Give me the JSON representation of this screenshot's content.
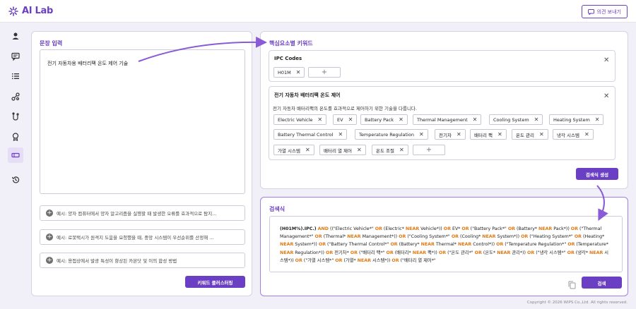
{
  "app": {
    "logo_text": "AI Lab",
    "feedback_label": "의견 보내기"
  },
  "nav": {
    "icons": [
      "user-icon",
      "chat-icon",
      "list-icon",
      "network-icon",
      "flow-icon",
      "award-icon",
      "ticket-icon",
      "history-icon"
    ],
    "active_index": 6
  },
  "input_panel": {
    "title": "문장 입력",
    "text": "전기 자동차용 배터리팩 온도 제어 기술",
    "examples": [
      "예시: 양자 컴퓨터에서 양자 알고리즘을 실행할 때 발생한 오류를 효과적으로 탐지...",
      "예시: 로봇택시가 원격지 도움을 요청했을 때, 중앙 시스템이 우선순위를 산정해 ...",
      "예시: 용접상에서 발광 특성이 향상된 카본닷 및 이의 합성 방법"
    ],
    "cluster_button": "키워드 클러스터링"
  },
  "keyword_panel": {
    "title": "핵심요소별 키워드",
    "ipc_card": {
      "title": "IPC Codes",
      "chips": [
        "H01M"
      ]
    },
    "topic_card": {
      "title": "전기 자동차 배터리팩 온도 제어",
      "description": "전기 자동차 배터리팩의 온도를 효과적으로 제어하기 위한 기술을 다룹니다.",
      "chips": [
        "Electric Vehicle",
        "EV",
        "Battery Pack",
        "Thermal Management",
        "Cooling System",
        "Heating System",
        "Battery Thermal Control",
        "Temperature Regulation",
        "전기차",
        "배터리 팩",
        "온도 관리",
        "냉각 시스템",
        "가열 시스템",
        "배터리 열 제어",
        "온도 조절"
      ]
    },
    "generate_button": "검색식 생성"
  },
  "query_panel": {
    "title": "검색식",
    "tokens": [
      {
        "t": "(H01M%).IPC.)",
        "c": "b"
      },
      {
        "t": " "
      },
      {
        "t": "AND",
        "c": "o"
      },
      {
        "t": " ((\"Electric Vehicle*\" "
      },
      {
        "t": "OR",
        "c": "o"
      },
      {
        "t": " (Electric* "
      },
      {
        "t": "NEAR",
        "c": "o"
      },
      {
        "t": " Vehicle*)) "
      },
      {
        "t": "OR",
        "c": "o"
      },
      {
        "t": " EV* "
      },
      {
        "t": "OR",
        "c": "o"
      },
      {
        "t": " (\"Battery Pack*\" "
      },
      {
        "t": "OR",
        "c": "o"
      },
      {
        "t": " (Battery* "
      },
      {
        "t": "NEAR",
        "c": "o"
      },
      {
        "t": " Pack*)) "
      },
      {
        "t": "OR",
        "c": "o"
      },
      {
        "t": " (\"Thermal Management*\" "
      },
      {
        "t": "OR",
        "c": "o"
      },
      {
        "t": " (Thermal* "
      },
      {
        "t": "NEAR",
        "c": "o"
      },
      {
        "t": " Management*)) "
      },
      {
        "t": "OR",
        "c": "o"
      },
      {
        "t": " (\"Cooling System*\" "
      },
      {
        "t": "OR",
        "c": "o"
      },
      {
        "t": " (Cooling* "
      },
      {
        "t": "NEAR",
        "c": "o"
      },
      {
        "t": " System*)) "
      },
      {
        "t": "OR",
        "c": "o"
      },
      {
        "t": " (\"Heating System*\" "
      },
      {
        "t": "OR",
        "c": "o"
      },
      {
        "t": " (Heating* "
      },
      {
        "t": "NEAR",
        "c": "o"
      },
      {
        "t": " System*)) "
      },
      {
        "t": "OR",
        "c": "o"
      },
      {
        "t": " (\"Battery Thermal Control*\" "
      },
      {
        "t": "OR",
        "c": "o"
      },
      {
        "t": " (Battery* "
      },
      {
        "t": "NEAR",
        "c": "o"
      },
      {
        "t": " Thermal* "
      },
      {
        "t": "NEAR",
        "c": "o"
      },
      {
        "t": " Control*)) "
      },
      {
        "t": "OR",
        "c": "o"
      },
      {
        "t": " (\"Temperature Regulation*\" "
      },
      {
        "t": "OR",
        "c": "o"
      },
      {
        "t": " (Temperature* "
      },
      {
        "t": "NEAR",
        "c": "o"
      },
      {
        "t": " Regulation*)) "
      },
      {
        "t": "OR",
        "c": "o"
      },
      {
        "t": " 전기차* "
      },
      {
        "t": "OR",
        "c": "o"
      },
      {
        "t": " (\"배터리 팩*\" "
      },
      {
        "t": "OR",
        "c": "o"
      },
      {
        "t": " (배터리* "
      },
      {
        "t": "NEAR",
        "c": "o"
      },
      {
        "t": " 팩*)) "
      },
      {
        "t": "OR",
        "c": "o"
      },
      {
        "t": " (\"온도 관리*\" "
      },
      {
        "t": "OR",
        "c": "o"
      },
      {
        "t": " (온도* "
      },
      {
        "t": "NEAR",
        "c": "o"
      },
      {
        "t": " 관리*)) "
      },
      {
        "t": "OR",
        "c": "o"
      },
      {
        "t": " (\"냉각 시스템*\" "
      },
      {
        "t": "OR",
        "c": "o"
      },
      {
        "t": " (냉각* "
      },
      {
        "t": "NEAR",
        "c": "o"
      },
      {
        "t": " 시스템*)) "
      },
      {
        "t": "OR",
        "c": "o"
      },
      {
        "t": " (\"가열 시스템*\" "
      },
      {
        "t": "OR",
        "c": "o"
      },
      {
        "t": " (가열* "
      },
      {
        "t": "NEAR",
        "c": "o"
      },
      {
        "t": " 시스템*)) "
      },
      {
        "t": "OR",
        "c": "o"
      },
      {
        "t": " (\"배터리 열 제어*\""
      }
    ],
    "search_button": "검색"
  },
  "footer": {
    "copyright": "Copyright © 2026 WIPS Co.,Ltd. All rights reserved."
  },
  "colors": {
    "accent": "#6b3fc4",
    "operator": "#e07a14"
  }
}
